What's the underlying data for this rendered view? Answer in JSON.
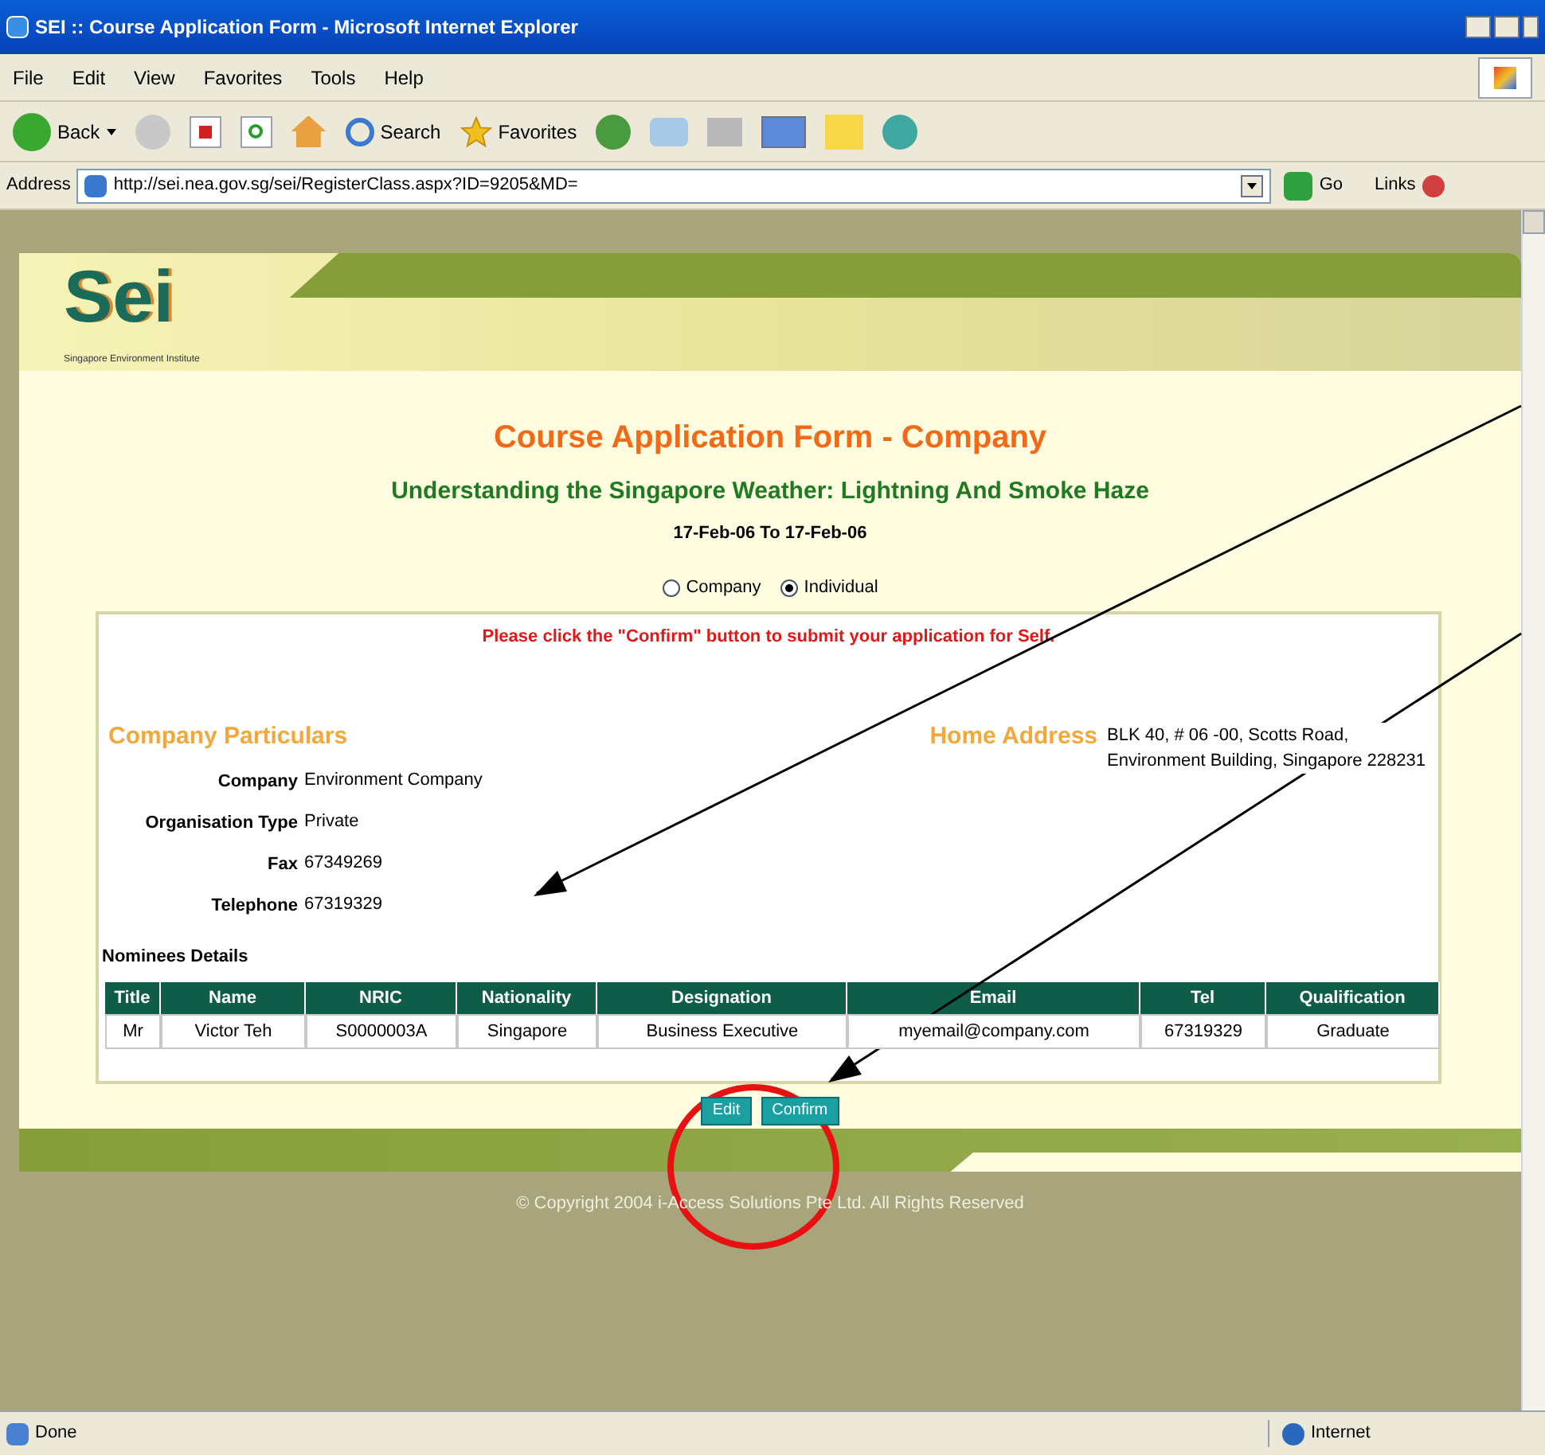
{
  "window": {
    "title": "SEI :: Course Application Form - Microsoft Internet Explorer"
  },
  "menu": [
    "File",
    "Edit",
    "View",
    "Favorites",
    "Tools",
    "Help"
  ],
  "toolbar": {
    "back": "Back",
    "search": "Search",
    "favorites": "Favorites"
  },
  "address_bar": {
    "label": "Address",
    "url": "http://sei.nea.gov.sg/sei/RegisterClass.aspx?ID=9205&MD=",
    "go": "Go",
    "links": "Links"
  },
  "page": {
    "logo": "Sei",
    "logo_tagline": "Singapore Environment Institute",
    "heading": "Course Application Form - Company",
    "course": "Understanding the Singapore Weather: Lightning And Smoke Haze",
    "dates": "17-Feb-06 To 17-Feb-06",
    "radios": [
      {
        "label": "Company",
        "selected": false
      },
      {
        "label": "Individual",
        "selected": true
      }
    ],
    "notice": "Please click the \"Confirm\" button to submit your application for Self.",
    "company_title": "Company Particulars",
    "fields": [
      {
        "label": "Company",
        "value": "Environment Company"
      },
      {
        "label": "Organisation Type",
        "value": "Private"
      },
      {
        "label": "Fax",
        "value": "67349269"
      },
      {
        "label": "Telephone",
        "value": "67319329"
      }
    ],
    "home_address": {
      "label": "Home Address",
      "lines": [
        "BLK 40, # 06 -00, Scotts Road,",
        "Environment Building, Singapore 228231"
      ]
    },
    "nominees_title": "Nominees Details",
    "table": {
      "columns": [
        "Title",
        "Name",
        "NRIC",
        "Nationality",
        "Designation",
        "Email",
        "Tel",
        "Qualification"
      ],
      "rows": [
        [
          "Mr",
          "Victor Teh",
          "S0000003A",
          "Singapore",
          "Business Executive",
          "myemail@company.com",
          "67319329",
          "Graduate"
        ]
      ]
    },
    "buttons": [
      "Edit",
      "Confirm"
    ],
    "copyright": "© Copyright 2004 i-Access Solutions Pte Ltd. All Rights Reserved"
  },
  "status_bar": {
    "text": "Done",
    "zone": "Internet"
  }
}
